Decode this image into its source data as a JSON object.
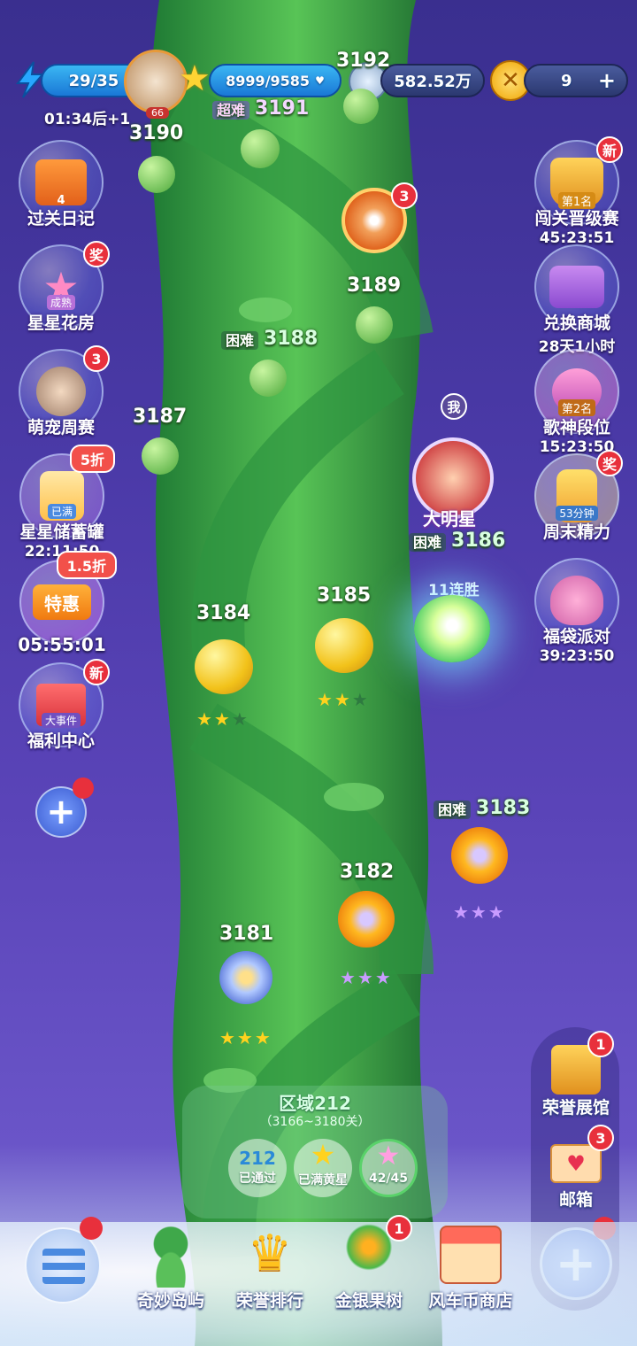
{
  "topbar": {
    "energy": "29/35",
    "energy_timer": "01:34后+1",
    "avatar_level": "66",
    "stars": "8999/9585",
    "coins": "582.52万",
    "gold": "9",
    "plus": "+"
  },
  "left_menu": [
    {
      "label": "过关日记",
      "sub": "4"
    },
    {
      "label": "星星花房",
      "badge": "奖",
      "sub": "成熟"
    },
    {
      "label": "萌宠周赛",
      "badge": "3"
    },
    {
      "label": "星星储蓄罐",
      "badge": "5折",
      "sub": "已满",
      "timer": "22:11:50"
    },
    {
      "label": "特惠",
      "badge": "1.5折",
      "timer": "05:55:01"
    },
    {
      "label": "福利中心",
      "badge": "新",
      "sub": "大事件"
    }
  ],
  "right_menu": [
    {
      "label": "闯关晋级赛",
      "badge": "新",
      "sub": "第1名",
      "timer": "45:23:51"
    },
    {
      "label": "兑换商城",
      "timer": "28天1小时"
    },
    {
      "label": "歌神段位",
      "sub": "第2名",
      "timer": "15:23:50"
    },
    {
      "label": "周末精力",
      "badge": "奖",
      "sub": "53分钟"
    },
    {
      "label": "福袋派对",
      "timer": "39:23:50"
    }
  ],
  "levels": {
    "l3192": "3192",
    "l3191": "3191",
    "l3191_diff": "超难",
    "l3190": "3190",
    "l3189": "3189",
    "l3188": "3188",
    "l3188_diff": "困难",
    "l3187": "3187",
    "l3186": "3186",
    "l3186_diff": "困难",
    "l3185": "3185",
    "l3184": "3184",
    "l3183": "3183",
    "l3183_diff": "困难",
    "l3182": "3182",
    "l3181": "3181",
    "chest_badge": "3",
    "me_label": "我",
    "player_name": "大明星",
    "streak": "11连胜"
  },
  "zone": {
    "title": "区域212",
    "range": "（3166~3180关）",
    "passed_num": "212",
    "passed_label": "已通过",
    "gold_label": "已满黄星",
    "progress": "42/45"
  },
  "right_bottom": [
    {
      "label": "荣誉展馆",
      "badge": "1"
    },
    {
      "label": "邮箱",
      "badge": "3"
    }
  ],
  "bottom_nav": [
    {
      "label": "奇妙岛屿"
    },
    {
      "label": "荣誉排行"
    },
    {
      "label": "金银果树",
      "badge": "1"
    },
    {
      "label": "风车币商店"
    }
  ],
  "colors": {
    "accent": "#1a78d6",
    "badge": "#e8303c",
    "stalk": "#3fa84a"
  }
}
